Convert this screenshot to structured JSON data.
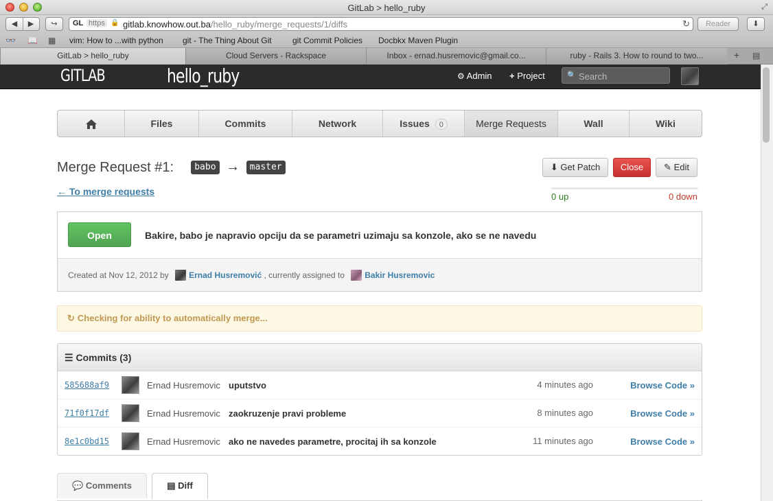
{
  "browser": {
    "window_title": "GitLab > hello_ruby",
    "url_favicon": "GL",
    "url_scheme": "https",
    "url_host": "gitlab.knowhow.out.ba",
    "url_path": "/hello_ruby/merge_requests/1/diffs",
    "reader_label": "Reader",
    "bookmarks": [
      "vim: How to ...with python",
      "git - The Thing About Git",
      "git Commit Policies",
      "Docbkx Maven Plugin"
    ],
    "tabs": [
      {
        "label": "GitLab > hello_ruby"
      },
      {
        "label": "Cloud Servers - Rackspace"
      },
      {
        "label": "Inbox - ernad.husremovic@gmail.co..."
      },
      {
        "label": "ruby - Rails 3. How to round to two..."
      }
    ]
  },
  "header": {
    "logo": "GITLAB",
    "project": "hello_ruby",
    "admin_label": "Admin",
    "project_label": "Project",
    "search_placeholder": "Search"
  },
  "project_nav": {
    "items": [
      "Files",
      "Commits",
      "Network",
      "Issues",
      "Merge Requests",
      "Wall",
      "Wiki"
    ],
    "issues_count": "0"
  },
  "merge_request": {
    "title": "Merge Request #1:",
    "source_branch": "babo",
    "arrow": "→",
    "target_branch": "master",
    "back_link": "← To merge requests",
    "get_patch_label": "Get Patch",
    "close_label": "Close",
    "edit_label": "Edit",
    "votes_up": "0 up",
    "votes_down": "0 down",
    "state": "Open",
    "description": "Bakire, babo je napravio opciju da se parametri uzimaju sa konzole, ako se ne navedu",
    "created_prefix": "Created at Nov 12, 2012 by",
    "author": "Ernad Husremović",
    "assigned_prefix": ", currently assigned to",
    "assignee": "Bakir Husremovic",
    "merge_check": "Checking for ability to automatically merge..."
  },
  "commits": {
    "heading": "Commits (3)",
    "browse_label": "Browse Code »",
    "rows": [
      {
        "sha": "585688af9",
        "author": "Ernad Husremovic",
        "message": "uputstvo",
        "time": "4 minutes ago"
      },
      {
        "sha": "71f0f17df",
        "author": "Ernad Husremovic",
        "message": "zaokruzenje pravi probleme",
        "time": "8 minutes ago"
      },
      {
        "sha": "8e1c0bd15",
        "author": "Ernad Husremovic",
        "message": "ako ne navedes parametre, procitaj ih sa konzole",
        "time": "11 minutes ago"
      }
    ]
  },
  "bottom_tabs": {
    "comments_label": "Comments",
    "diff_label": "Diff"
  },
  "colors": {
    "header_bg": "#2b2b2b",
    "link": "#3e7ea8",
    "open_green": "#5bb75b",
    "close_red": "#da4f49",
    "warning_text": "#c09853"
  }
}
